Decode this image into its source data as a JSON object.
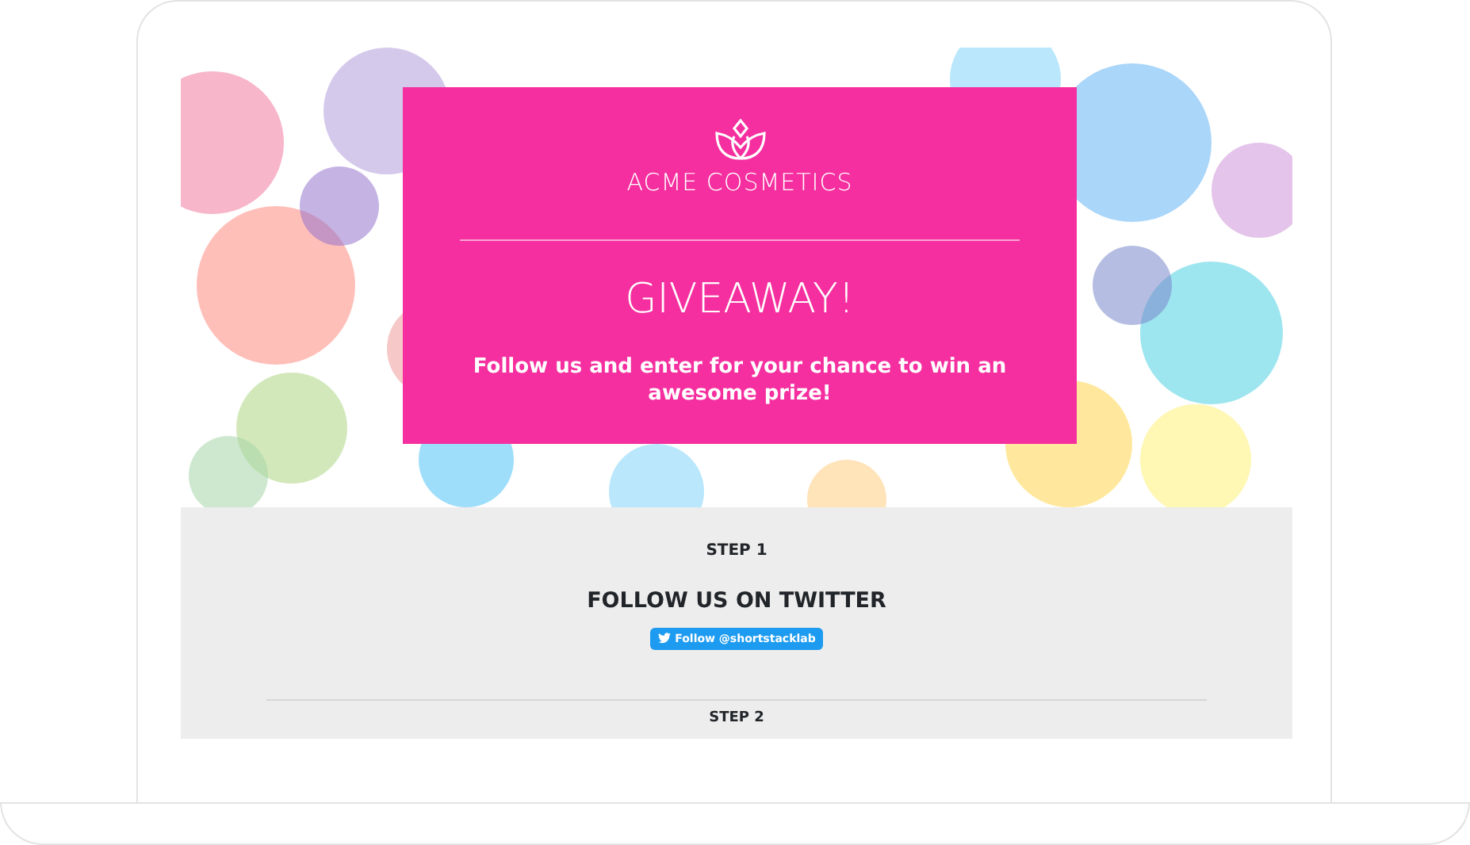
{
  "hero": {
    "brand": "ACME COSMETICS",
    "title": "GIVEAWAY!",
    "subtitle": "Follow us and enter for your chance to win an awesome prize!"
  },
  "steps": [
    {
      "label": "STEP 1",
      "heading": "FOLLOW US ON TWITTER",
      "button": "Follow @shortstacklab"
    },
    {
      "label": "STEP 2"
    }
  ]
}
